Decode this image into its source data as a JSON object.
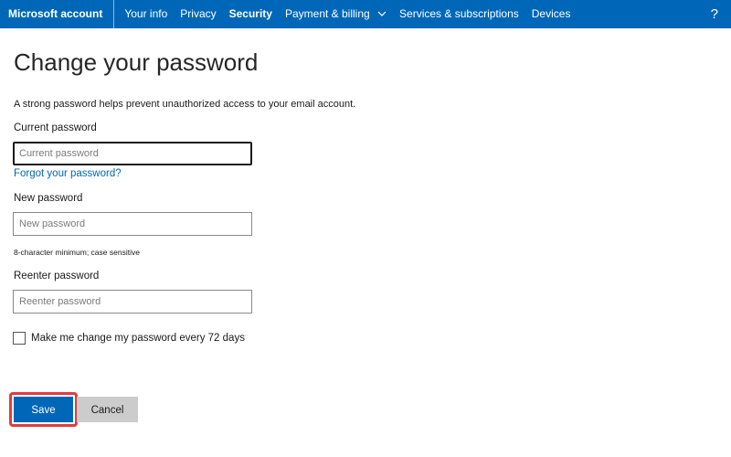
{
  "topbar": {
    "brand": "Microsoft account",
    "nav": [
      {
        "label": "Your info"
      },
      {
        "label": "Privacy"
      },
      {
        "label": "Security"
      },
      {
        "label": "Payment & billing"
      },
      {
        "label": "Services & subscriptions"
      },
      {
        "label": "Devices"
      }
    ],
    "active_item": "Security",
    "help": "?"
  },
  "page": {
    "title": "Change your password",
    "description": "A strong password helps prevent unauthorized access to your email account."
  },
  "form": {
    "current": {
      "label": "Current password",
      "placeholder": "Current password",
      "value": ""
    },
    "forgot_link": "Forgot your password?",
    "new": {
      "label": "New password",
      "placeholder": "New password",
      "value": "",
      "hint": "8-character minimum; case sensitive"
    },
    "reenter": {
      "label": "Reenter password",
      "placeholder": "Reenter password",
      "value": ""
    },
    "expire_checkbox": {
      "label": "Make me change my password every 72 days",
      "checked": false
    }
  },
  "actions": {
    "save": "Save",
    "cancel": "Cancel"
  },
  "colors": {
    "brand_blue": "#0067b8",
    "highlight_red": "#e03c3c",
    "cancel_gray": "#cccccc"
  },
  "icons": {
    "payment_dropdown": "chevron-down-icon",
    "help": "help-icon"
  }
}
